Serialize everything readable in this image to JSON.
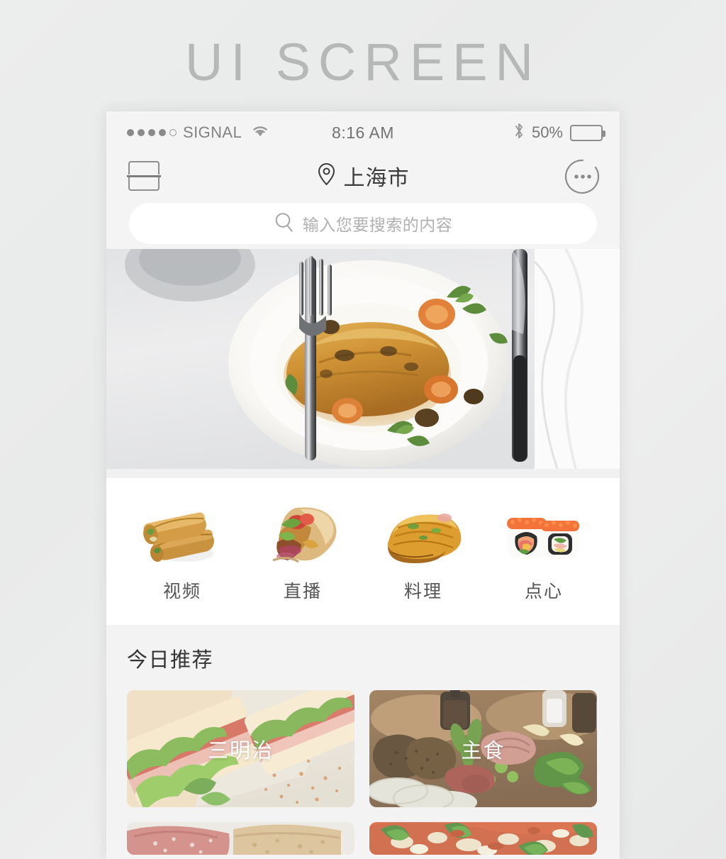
{
  "page": {
    "heading": "UI SCREEN",
    "heading_color": "#b6b8b8",
    "background_color": "#ebecec"
  },
  "statusbar": {
    "signal_dots_total": 5,
    "signal_dots_filled": 4,
    "carrier": "SIGNAL",
    "wifi_icon": "wifi-icon",
    "time": "8:16 AM",
    "bluetooth_icon": "bluetooth-icon",
    "battery_percent_label": "50%",
    "battery_level": 50
  },
  "navbar": {
    "menu_icon": "split-view-icon",
    "location_icon": "location-pin-icon",
    "title": "上海市",
    "more_icon": "more-dots-circle-icon"
  },
  "search": {
    "icon": "search-icon",
    "placeholder": "输入您要搜索的内容",
    "value": ""
  },
  "hero": {
    "alt": "plated-chicken-dish-with-fork-and-knife",
    "interactable": true
  },
  "categories": [
    {
      "label": "视频",
      "image": "spring-rolls-thumb"
    },
    {
      "label": "直播",
      "image": "wrap-sandwich-thumb"
    },
    {
      "label": "料理",
      "image": "omelette-thumb"
    },
    {
      "label": "点心",
      "image": "sushi-roll-thumb"
    }
  ],
  "recommend": {
    "title": "今日推荐",
    "cards": [
      {
        "label": "三明治",
        "image": "sandwich-photo"
      },
      {
        "label": "主食",
        "image": "charcuterie-platter-photo"
      },
      {
        "label": "",
        "image": "salami-and-bread-photo"
      },
      {
        "label": "",
        "image": "pizza-photo"
      }
    ]
  },
  "colors": {
    "chrome": "#f4f4f4",
    "section_bg": "#f3f3f3",
    "card_white": "#ffffff",
    "text_primary": "#333333",
    "text_muted": "#8a8a8a",
    "placeholder": "#b0b0b0"
  }
}
